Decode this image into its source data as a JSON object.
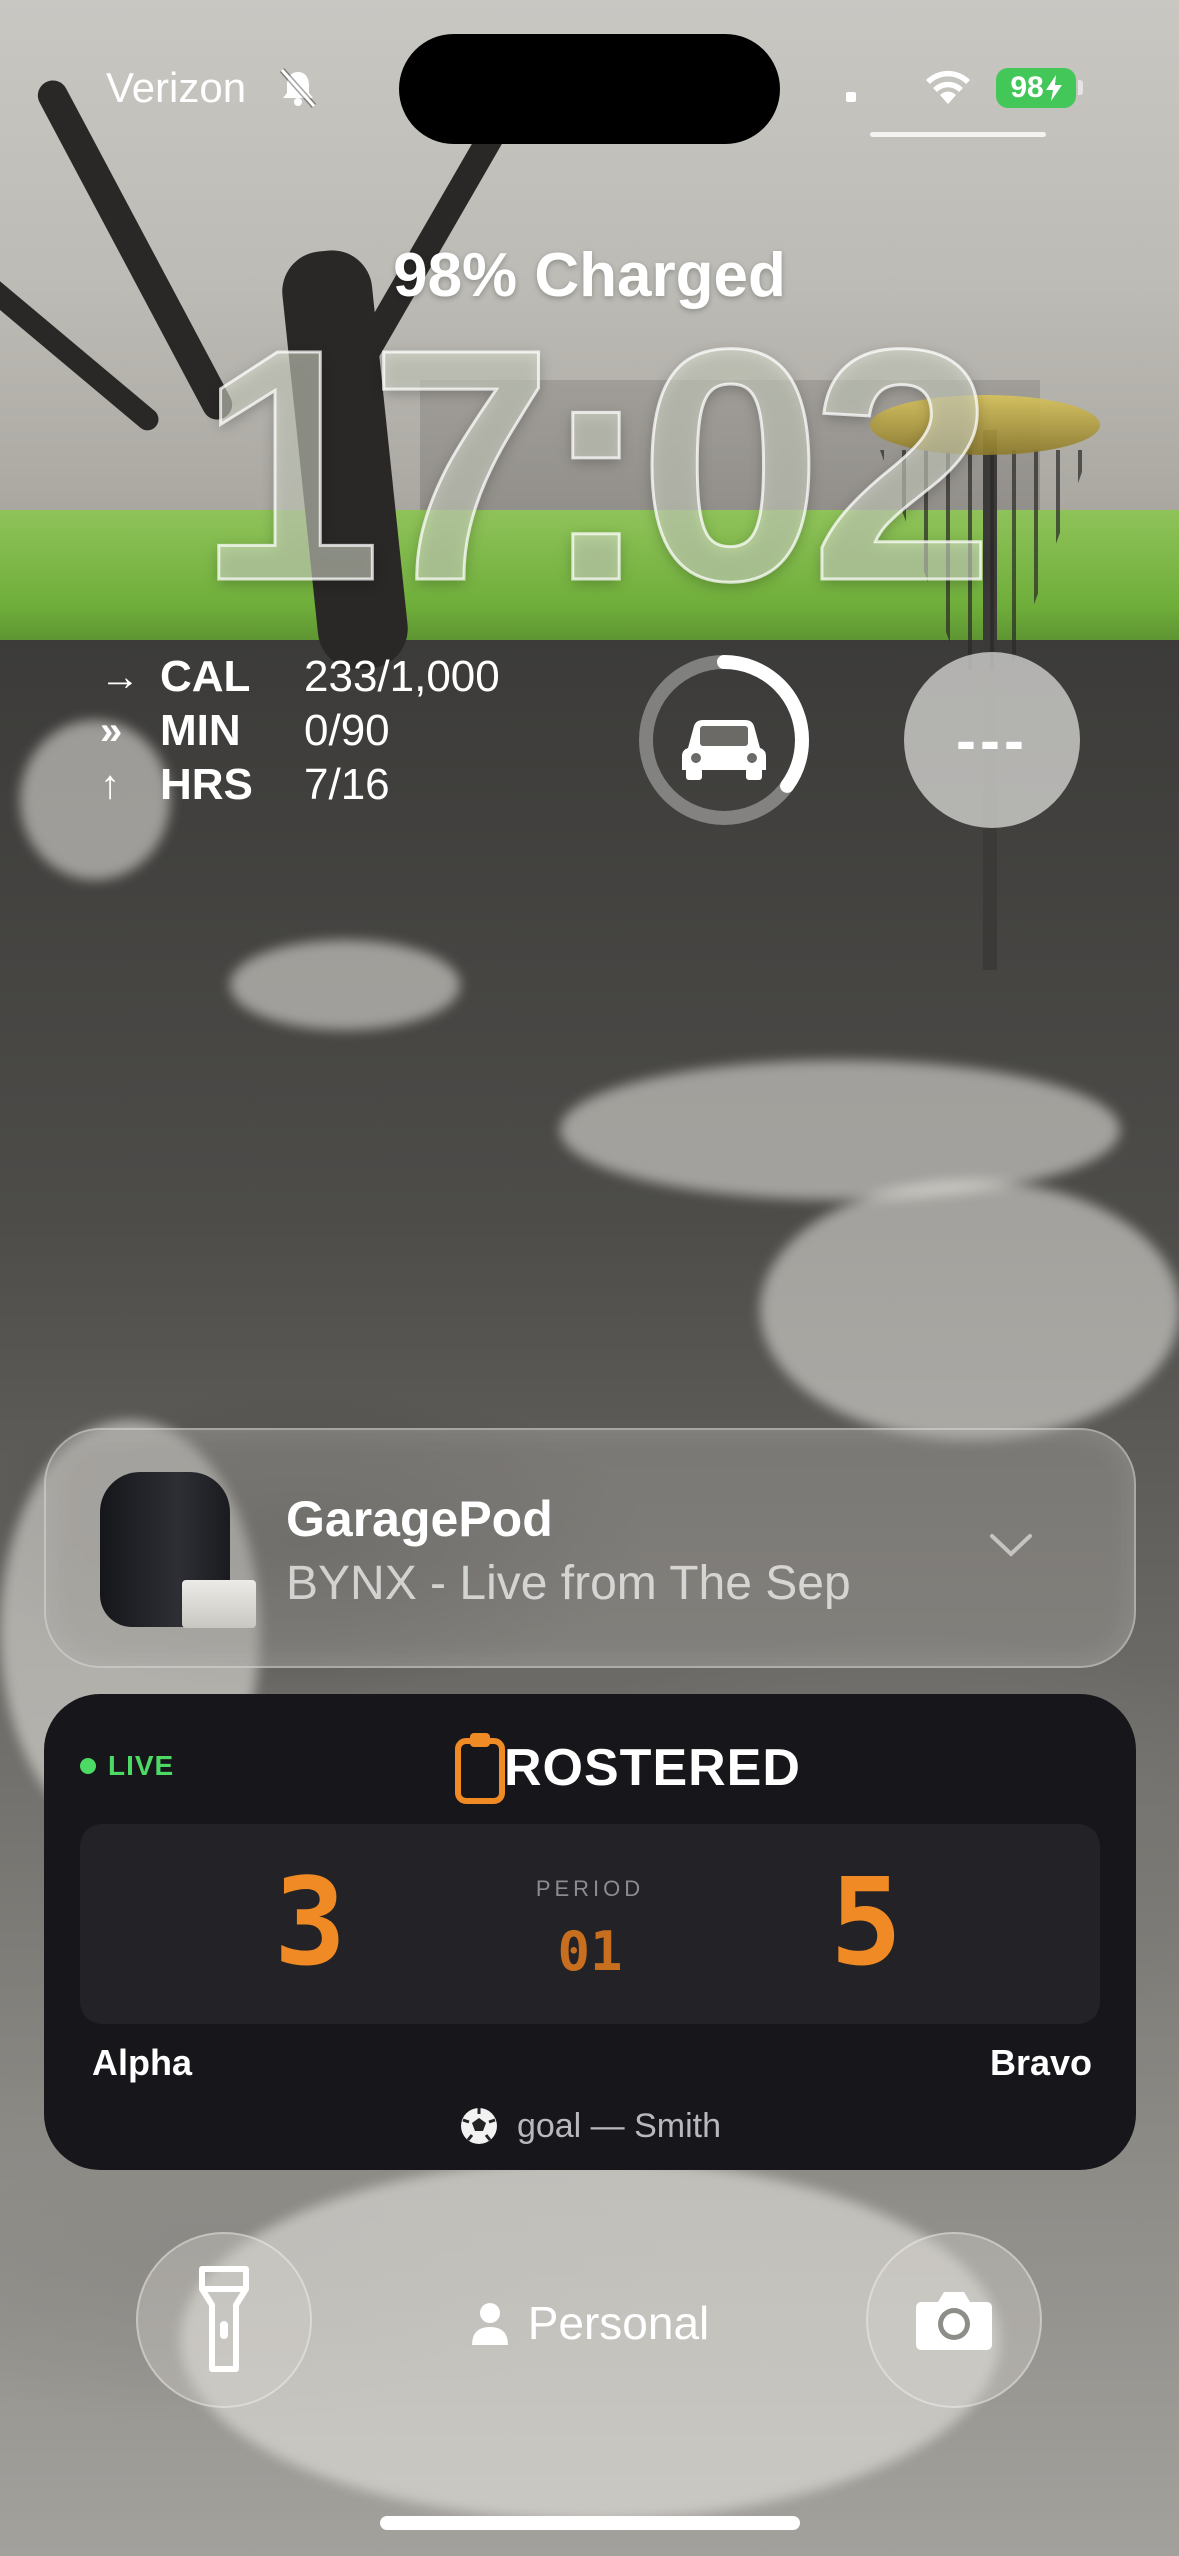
{
  "status_bar": {
    "carrier": "Verizon",
    "battery_level": "98",
    "battery_color": "#43c759",
    "icons": [
      "bell-slash-icon",
      "wifi-icon",
      "battery-charging-icon"
    ]
  },
  "lock_screen": {
    "charge_status": "98% Charged",
    "time": "17:02"
  },
  "activity_widget": {
    "rows": [
      {
        "arrow": "→",
        "label": "CAL",
        "value": "233/1,000"
      },
      {
        "arrow": "»",
        "label": "MIN",
        "value": "0/90"
      },
      {
        "arrow": "↑",
        "label": "HRS",
        "value": "7/16"
      }
    ]
  },
  "car_widget": {
    "icon": "car-icon",
    "ring_progress": 0.35
  },
  "circle_widget": {
    "text": "---"
  },
  "now_playing": {
    "device": "GaragePod",
    "track": "BYNX - Live from The Sep",
    "icon": "chevron-down-icon"
  },
  "live_activity": {
    "live_label": "LIVE",
    "live_color": "#4cd964",
    "brand": "ROSTERED",
    "accent_color": "#f08a24",
    "home_score": "3",
    "away_score": "5",
    "period_label": "PERIOD",
    "period_value": "01",
    "home_team": "Alpha",
    "away_team": "Bravo",
    "event": "goal — Smith",
    "event_icon": "soccer-ball-icon"
  },
  "bottom_controls": {
    "focus_mode": "Personal",
    "left_icon": "flashlight-icon",
    "right_icon": "camera-icon"
  }
}
